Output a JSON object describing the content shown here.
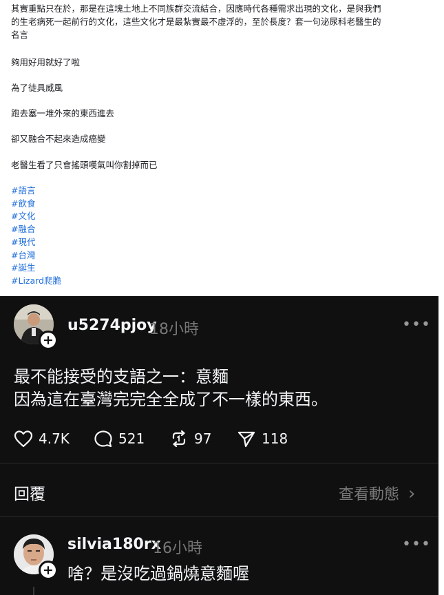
{
  "post": {
    "paragraphs": [
      "其實重點只在於，那是在這塊土地上不同族群交流結合，因應時代各種需求出現的文化，是與我們",
      "的生老病死一起前行的文化，這些文化才是最紮實最不虛浮的，至於長度？套一句泌尿科老醫生的",
      "名言",
      "夠用好用就好了啦",
      "為了徒具威風",
      "跑去塞一堆外來的東西進去",
      "卻又融合不起來造成癌變",
      "老醫生看了只會搖頭嘆氣叫你割掉而已"
    ],
    "hashtags": [
      "#語言",
      "#飲食",
      "#文化",
      "#融合",
      "#現代",
      "#台灣",
      "#誕生",
      "#Lizard爬脆"
    ]
  },
  "thread": {
    "main": {
      "username": "u5274pjoy",
      "time": "18小時",
      "more": "•••",
      "text_lines": [
        "最不能接受的支語之一：意麵",
        "因為這在臺灣完完全全成了不一樣的東西。"
      ],
      "likes": "4.7K",
      "comments": "521",
      "reposts": "97",
      "shares": "118"
    },
    "reply_label": "回覆",
    "view_activity": "查看動態",
    "chevron": "›",
    "reply": {
      "username": "silvia180rx",
      "time": "16小時",
      "more": "•••",
      "text": "啥？是沒吃過鍋燒意麵喔"
    },
    "plus": "+"
  },
  "colors": {
    "hashtag": "#216fdb",
    "dark_bg": "#101010",
    "muted": "#777777"
  }
}
